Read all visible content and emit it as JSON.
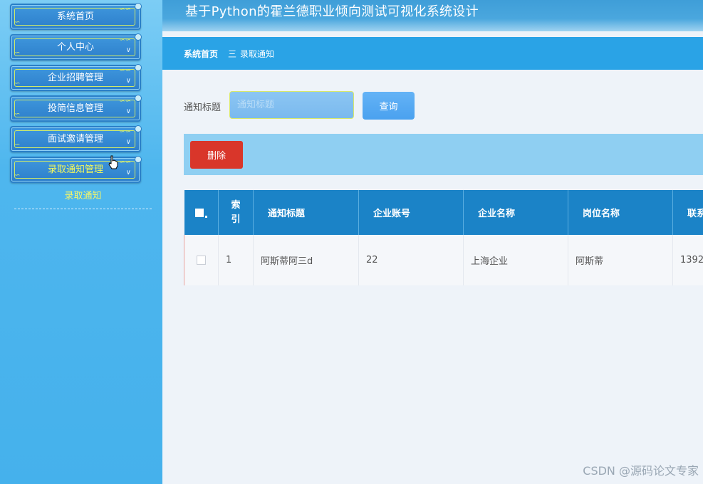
{
  "header": {
    "title": "基于Python的霍兰德职业倾向测试可视化系统设计"
  },
  "sidebar": {
    "items": [
      {
        "label": "系统首页"
      },
      {
        "label": "个人中心"
      },
      {
        "label": "企业招聘管理"
      },
      {
        "label": "投简信息管理"
      },
      {
        "label": "面试邀请管理"
      },
      {
        "label": "录取通知管理"
      }
    ],
    "submenu": {
      "label": "录取通知"
    }
  },
  "breadcrumb": {
    "home": "系统首页",
    "separator": "三",
    "current": "录取通知"
  },
  "search": {
    "label": "通知标题",
    "placeholder": "通知标题",
    "button": "查询"
  },
  "toolbar": {
    "delete_label": "删除"
  },
  "table": {
    "columns": [
      "",
      "索引",
      "通知标题",
      "企业账号",
      "企业名称",
      "岗位名称",
      "联系"
    ],
    "rows": [
      {
        "index": "1",
        "title": "阿斯蒂阿三d",
        "account": "22",
        "company": "上海企业",
        "position": "阿斯蒂",
        "contact": "1392"
      }
    ]
  },
  "watermark": "CSDN @源码论文专家",
  "colors": {
    "sidebar": "#4eb6ee",
    "header": "#3f9ed8",
    "breadcrumb": "#2aa3e6",
    "table_header": "#1b83c7",
    "delete": "#d9362a",
    "menu_highlight": "#f5f95a"
  }
}
